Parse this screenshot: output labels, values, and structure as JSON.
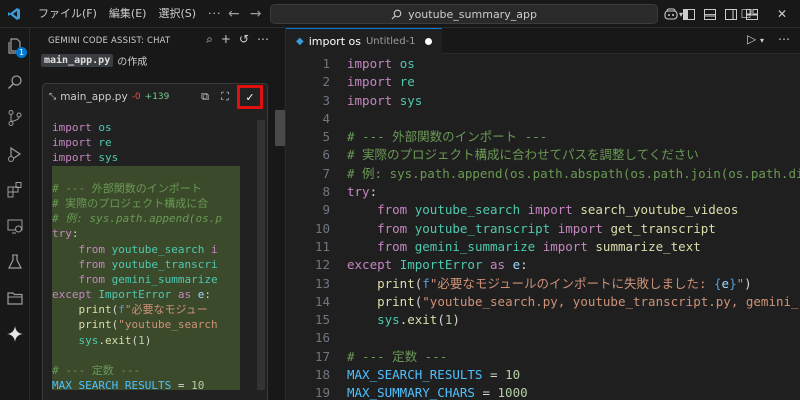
{
  "titlebar": {
    "menus": [
      "ファイル(F)",
      "編集(E)",
      "選択(S)",
      "···"
    ],
    "search_text": "youtube_summary_app"
  },
  "sidepanel": {
    "title": "GEMINI CODE ASSIST: CHAT",
    "file_chip": "main_app.py",
    "creating_suffix": "の作成",
    "codeblock": {
      "filename": "main_app.py",
      "deletions": "-0",
      "additions": "+139"
    }
  },
  "editor": {
    "tab_label": "import os",
    "tab_desc": "Untitled-1"
  },
  "colors": {
    "accent": "#0078d4",
    "apply_border": "#e01010",
    "comment": "#6a9955",
    "keyword": "#c586c0"
  },
  "icons": [
    "vscode-logo-icon",
    "arrow-left-icon",
    "arrow-right-icon",
    "search-icon",
    "copilot-icon",
    "layout-sidebar-icon",
    "layout-panel-icon",
    "layout-secondary-icon",
    "layout-customize-icon",
    "minimize-icon",
    "maximize-icon",
    "close-icon",
    "explorer-icon",
    "search-activity-icon",
    "source-control-icon",
    "run-debug-icon",
    "extensions-icon",
    "remote-icon",
    "testing-icon",
    "folder-icon",
    "gemini-icon",
    "new-chat-icon",
    "add-icon",
    "history-icon",
    "more-icon",
    "collapse-icon",
    "copy-icon",
    "expand-icon",
    "check-icon",
    "run-icon",
    "split-editor-icon"
  ]
}
